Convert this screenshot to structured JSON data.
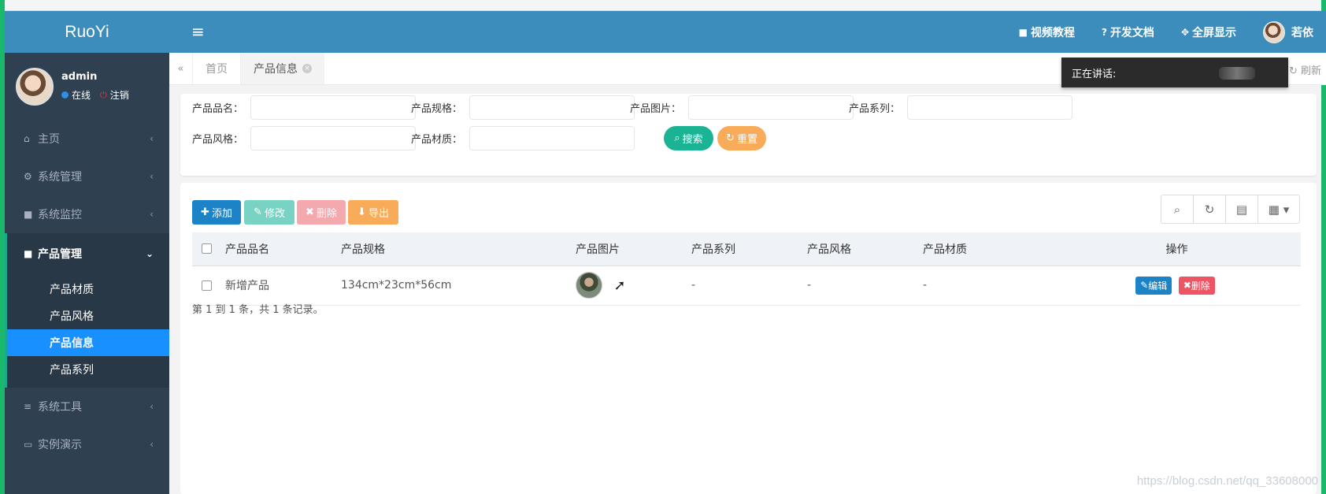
{
  "brand": "RuoYi",
  "user": {
    "name": "admin",
    "status_online": "在线",
    "logout": "注销"
  },
  "sidebar": {
    "items": [
      {
        "label": "主页",
        "icon": "home-icon"
      },
      {
        "label": "系统管理",
        "icon": "gear-icon"
      },
      {
        "label": "系统监控",
        "icon": "video-icon"
      },
      {
        "label": "产品管理",
        "icon": "video-icon"
      },
      {
        "label": "系统工具",
        "icon": "bars-icon"
      },
      {
        "label": "实例演示",
        "icon": "desktop-icon"
      }
    ],
    "submenu": [
      "产品材质",
      "产品风格",
      "产品信息",
      "产品系列"
    ]
  },
  "header": {
    "links": [
      "视频教程",
      "开发文档",
      "全屏显示"
    ],
    "user_name": "若依"
  },
  "tabs": {
    "home": "首页",
    "current": "产品信息",
    "refresh": "刷新"
  },
  "speaking": {
    "label": "正在讲话:"
  },
  "search": {
    "fields": [
      {
        "label": "产品品名：",
        "value": ""
      },
      {
        "label": "产品规格：",
        "value": ""
      },
      {
        "label": "产品图片：",
        "value": ""
      },
      {
        "label": "产品系列：",
        "value": ""
      },
      {
        "label": "产品风格：",
        "value": ""
      },
      {
        "label": "产品材质：",
        "value": ""
      }
    ],
    "search_btn": "搜索",
    "reset_btn": "重置"
  },
  "toolbar": {
    "add": "添加",
    "edit": "修改",
    "delete": "删除",
    "export": "导出"
  },
  "table": {
    "columns": [
      "产品品名",
      "产品规格",
      "产品图片",
      "产品系列",
      "产品风格",
      "产品材质",
      "操作"
    ],
    "rows": [
      {
        "name": "新增产品",
        "spec": "134cm*23cm*56cm",
        "series": "-",
        "style": "-",
        "material": "-",
        "edit": "编辑",
        "delete": "删除"
      }
    ],
    "pager": "第 1 到 1 条，共 1 条记录。"
  },
  "watermark": "https://blog.csdn.net/qq_33608000"
}
